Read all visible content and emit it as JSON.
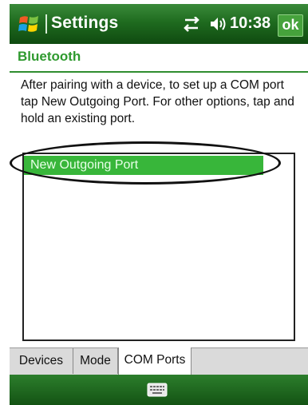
{
  "statusbar": {
    "title": "Settings",
    "time": "10:38",
    "ok_label": "ok",
    "icons": [
      "windows-start-flag-icon",
      "connectivity-icon",
      "volume-icon"
    ]
  },
  "page": {
    "header": "Bluetooth",
    "instructions": "After pairing with a device, to set up a COM port tap New Outgoing Port. For other options, tap and hold an existing port."
  },
  "port_list": {
    "items": [
      "New Outgoing Port"
    ]
  },
  "tabs": [
    "Devices",
    "Mode",
    "COM Ports"
  ],
  "bottombar": {
    "icon": "keyboard-icon"
  },
  "colors": {
    "bar_green": "#1f6b1f",
    "header_green": "#2f9a2f",
    "selection_green": "#38b63a"
  }
}
